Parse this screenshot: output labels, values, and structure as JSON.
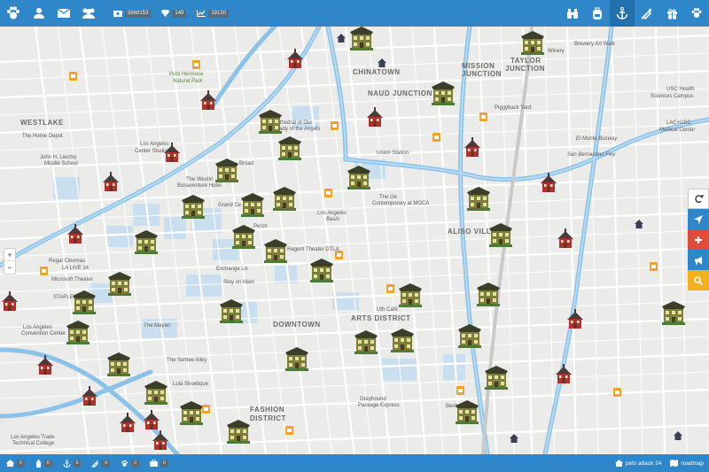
{
  "topbar": {
    "stats": [
      {
        "icon": "money-icon",
        "value": "5668153"
      },
      {
        "icon": "diamond-icon",
        "value": "149"
      },
      {
        "icon": "chart-line-icon",
        "value": "18130"
      }
    ],
    "right_icons": [
      "binoculars-icon",
      "backpack-icon",
      "anchor-icon",
      "syringe-icon",
      "gift-icon",
      "paw-icon"
    ]
  },
  "map": {
    "districts": [
      {
        "text": "CHINATOWN"
      },
      {
        "text": "MISSION"
      },
      {
        "text": "JUNCTION"
      },
      {
        "text": "TAYLOR"
      },
      {
        "text": "JUNCTION"
      },
      {
        "text": "NAUD JUNCTION"
      },
      {
        "text": "WESTLAKE"
      },
      {
        "text": "DOWNTOWN"
      },
      {
        "text": "ARTS DISTRICT"
      },
      {
        "text": "FASHION"
      },
      {
        "text": "DISTRICT"
      },
      {
        "text": "ALISO VILL"
      }
    ],
    "pois": [
      {
        "text": "Brewery Art Walk"
      },
      {
        "text": "Winery"
      },
      {
        "text": "USC Health"
      },
      {
        "text": "Sciences Campus"
      },
      {
        "text": "LAC+USC"
      },
      {
        "text": "Medical Center"
      },
      {
        "text": "Piggyback Yard"
      },
      {
        "text": "The Home Depot"
      },
      {
        "text": "John H. Liechty"
      },
      {
        "text": "Middle School"
      },
      {
        "text": "Los Angeles"
      },
      {
        "text": "Center Studios"
      },
      {
        "text": "Vista Hermosa"
      },
      {
        "text": "Natural Park"
      },
      {
        "text": "Cathedral of Our"
      },
      {
        "text": "Lady of the Angels"
      },
      {
        "text": "Union Station"
      },
      {
        "text": "The Westin"
      },
      {
        "text": "Bonaventure Hotel"
      },
      {
        "text": "Broad"
      },
      {
        "text": "Grand Ce"
      },
      {
        "text": "Regent Theater DTLA"
      },
      {
        "text": "Regal Cinemas"
      },
      {
        "text": "LA LIVE 14"
      },
      {
        "text": "Microsoft Theater"
      },
      {
        "text": "Exchange LA"
      },
      {
        "text": "Stay on Main"
      },
      {
        "text": "Los Angeles"
      },
      {
        "text": "Convention Center"
      },
      {
        "text": "The Mayan"
      },
      {
        "text": "The Santee Alley"
      },
      {
        "text": "Lola Shoetique"
      },
      {
        "text": "Greyhound"
      },
      {
        "text": "Package Express"
      },
      {
        "text": "Los Angeles Trade"
      },
      {
        "text": "Technical College"
      },
      {
        "text": "El Monte Busway"
      },
      {
        "text": "San Bernardino Fwy"
      },
      {
        "text": "The Ge"
      },
      {
        "text": "Contemporary at MOCA"
      },
      {
        "text": "Los Angeles"
      },
      {
        "text": "Basin"
      },
      {
        "text": "Perch"
      },
      {
        "text": "Uth Café"
      },
      {
        "text": "Besh"
      },
      {
        "text": "STAPLE"
      }
    ],
    "zoom": {
      "plus": "+",
      "minus": "−"
    }
  },
  "side_tools": [
    {
      "icon": "refresh-icon",
      "bg": "#ffffff",
      "fg": "#333333"
    },
    {
      "icon": "location-arrow-icon",
      "bg": "#2f86c8",
      "fg": "#ffffff"
    },
    {
      "icon": "plus-icon",
      "bg": "#e14b3b",
      "fg": "#ffffff"
    },
    {
      "icon": "megaphone-icon",
      "bg": "#2f86c8",
      "fg": "#ffffff"
    },
    {
      "icon": "search-icon",
      "bg": "#f2b01e",
      "fg": "#ffffff"
    }
  ],
  "bottombar": {
    "stats": [
      {
        "icon": "home-icon",
        "value": "0"
      },
      {
        "icon": "bottle-icon",
        "value": "0"
      },
      {
        "icon": "anchor-icon",
        "value": "0"
      },
      {
        "icon": "syringe-icon",
        "value": "0"
      },
      {
        "icon": "paw-icon",
        "value": "0"
      },
      {
        "icon": "briefcase-icon",
        "value": "0"
      }
    ],
    "link1": "pets attack 24",
    "link2": "roadmap"
  },
  "colors": {
    "bar": "#2f86c8",
    "bar_dark": "#2270ad",
    "freeway": "#8fc3e8",
    "road": "#ffffff",
    "block": "#c6ddef"
  }
}
